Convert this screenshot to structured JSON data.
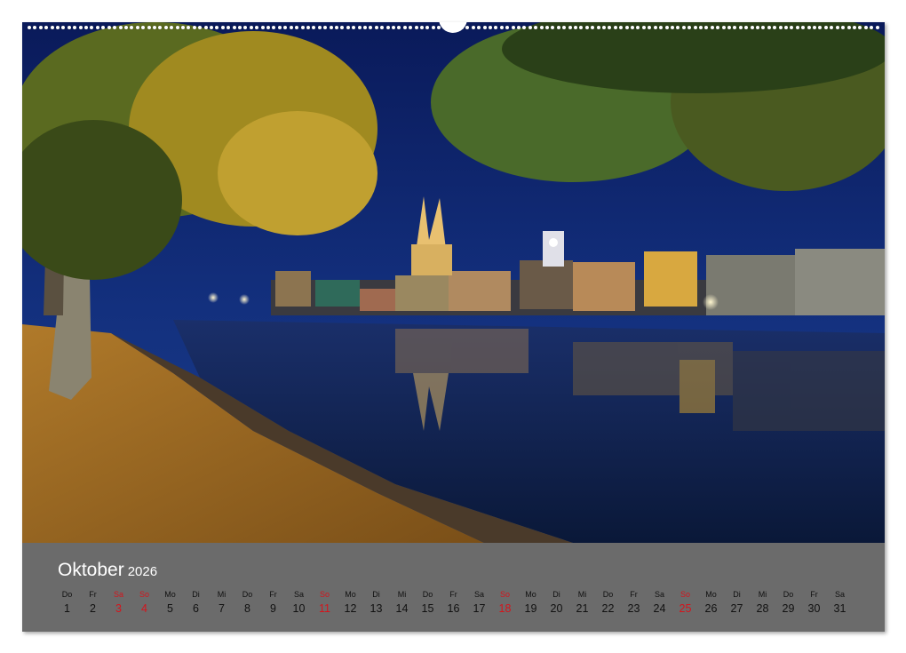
{
  "calendar": {
    "month": "Oktober",
    "year": "2026",
    "days": [
      {
        "dn": "Do",
        "num": "1",
        "red": false
      },
      {
        "dn": "Fr",
        "num": "2",
        "red": false
      },
      {
        "dn": "Sa",
        "num": "3",
        "red": true
      },
      {
        "dn": "So",
        "num": "4",
        "red": true
      },
      {
        "dn": "Mo",
        "num": "5",
        "red": false
      },
      {
        "dn": "Di",
        "num": "6",
        "red": false
      },
      {
        "dn": "Mi",
        "num": "7",
        "red": false
      },
      {
        "dn": "Do",
        "num": "8",
        "red": false
      },
      {
        "dn": "Fr",
        "num": "9",
        "red": false
      },
      {
        "dn": "Sa",
        "num": "10",
        "red": false
      },
      {
        "dn": "So",
        "num": "11",
        "red": true
      },
      {
        "dn": "Mo",
        "num": "12",
        "red": false
      },
      {
        "dn": "Di",
        "num": "13",
        "red": false
      },
      {
        "dn": "Mi",
        "num": "14",
        "red": false
      },
      {
        "dn": "Do",
        "num": "15",
        "red": false
      },
      {
        "dn": "Fr",
        "num": "16",
        "red": false
      },
      {
        "dn": "Sa",
        "num": "17",
        "red": false
      },
      {
        "dn": "So",
        "num": "18",
        "red": true
      },
      {
        "dn": "Mo",
        "num": "19",
        "red": false
      },
      {
        "dn": "Di",
        "num": "20",
        "red": false
      },
      {
        "dn": "Mi",
        "num": "21",
        "red": false
      },
      {
        "dn": "Do",
        "num": "22",
        "red": false
      },
      {
        "dn": "Fr",
        "num": "23",
        "red": false
      },
      {
        "dn": "Sa",
        "num": "24",
        "red": false
      },
      {
        "dn": "So",
        "num": "25",
        "red": true
      },
      {
        "dn": "Mo",
        "num": "26",
        "red": false
      },
      {
        "dn": "Di",
        "num": "27",
        "red": false
      },
      {
        "dn": "Mi",
        "num": "28",
        "red": false
      },
      {
        "dn": "Do",
        "num": "29",
        "red": false
      },
      {
        "dn": "Fr",
        "num": "30",
        "red": false
      },
      {
        "dn": "Sa",
        "num": "31",
        "red": false
      }
    ]
  },
  "colors": {
    "sunday_red": "#d4141c",
    "calendar_bg": "#6b6b6b"
  }
}
